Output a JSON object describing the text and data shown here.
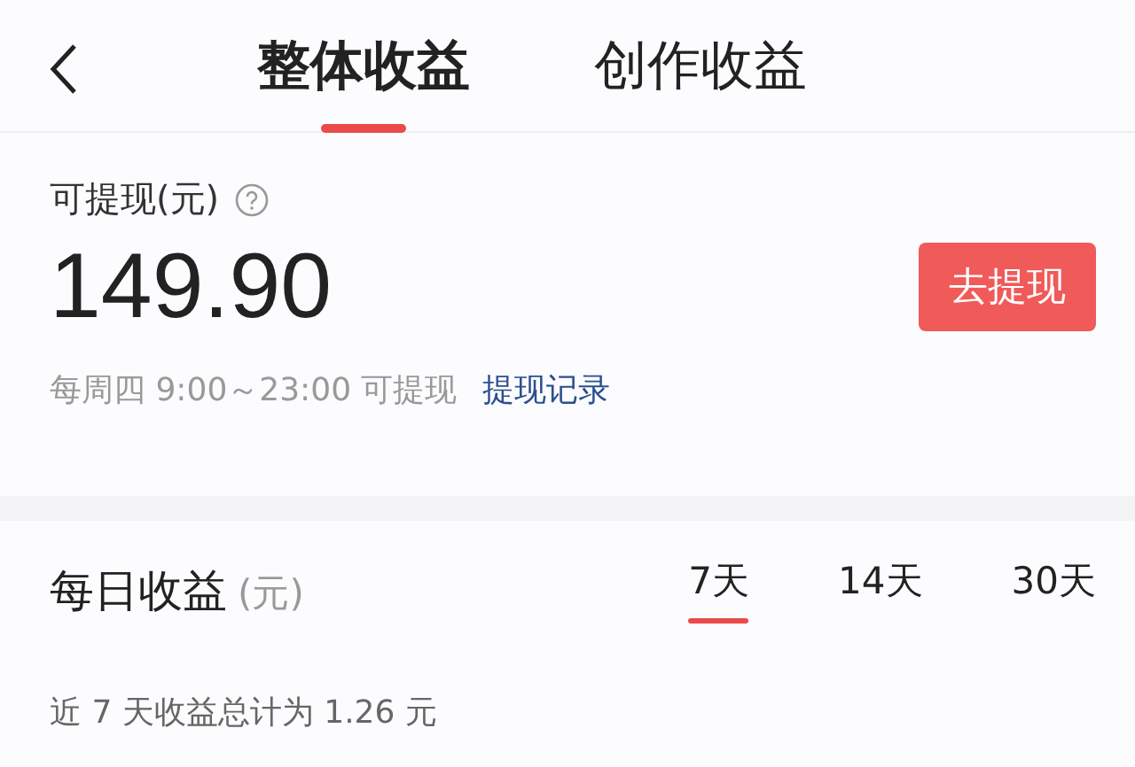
{
  "tabs": [
    {
      "label": "整体收益",
      "selected": true
    },
    {
      "label": "创作收益",
      "selected": false
    }
  ],
  "withdraw": {
    "label": "可提现(元)",
    "amount": "149.90",
    "button": "去提现",
    "hint": "每周四 9:00～23:00 可提现",
    "link": "提现记录"
  },
  "daily": {
    "title": "每日收益",
    "unit": "(元)",
    "periods": [
      {
        "label": "7天",
        "selected": true
      },
      {
        "label": "14天",
        "selected": false
      },
      {
        "label": "30天",
        "selected": false
      }
    ],
    "summary": "近 7 天收益总计为 1.26 元"
  }
}
